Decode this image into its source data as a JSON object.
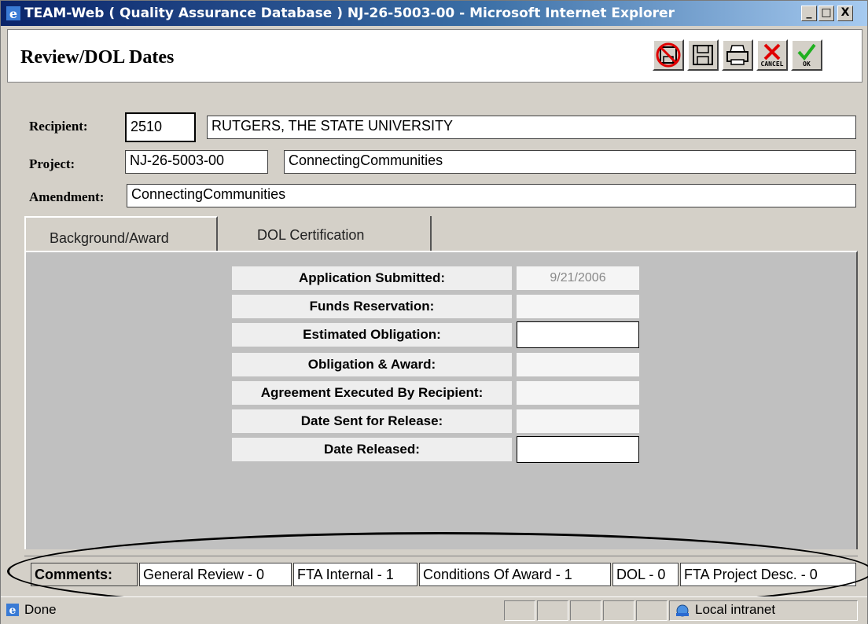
{
  "window": {
    "title": "TEAM-Web ( Quality Assurance Database ) NJ-26-5003-00 - Microsoft Internet Explorer",
    "minimize": "_",
    "maximize": "□",
    "close": "X"
  },
  "header": {
    "title": "Review/DOL Dates",
    "toolbar": {
      "cancel_label": "CANCEL",
      "ok_label": "OK"
    }
  },
  "form": {
    "recipient_label": "Recipient:",
    "recipient_id": "2510",
    "recipient_name": "RUTGERS, THE STATE UNIVERSITY",
    "project_label": "Project:",
    "project_id": "NJ-26-5003-00",
    "project_name": "ConnectingCommunities",
    "amendment_label": "Amendment:",
    "amendment_value": "ConnectingCommunities"
  },
  "tabs": [
    {
      "label": "Background/Award",
      "active": true
    },
    {
      "label": "DOL Certification",
      "active": false
    }
  ],
  "dates": [
    {
      "label": "Application Submitted:",
      "value": "9/21/2006"
    },
    {
      "label": "Funds Reservation:",
      "value": ""
    },
    {
      "label": "Estimated Obligation:",
      "value": ""
    },
    {
      "label": "Obligation & Award:",
      "value": ""
    },
    {
      "label": "Agreement Executed By Recipient:",
      "value": ""
    },
    {
      "label": "Date Sent for Release:",
      "value": ""
    },
    {
      "label": "Date Released:",
      "value": ""
    }
  ],
  "comments": {
    "label": "Comments:",
    "items": [
      "General Review - 0",
      "FTA Internal - 1",
      "Conditions Of Award - 1",
      "DOL - 0",
      "FTA Project Desc. - 0"
    ]
  },
  "statusbar": {
    "status": "Done",
    "zone": "Local intranet"
  },
  "colors": {
    "title_gradient_start": "#0a246a",
    "window_bg": "#d4d0c8",
    "panel_bg": "#c0c0c0"
  }
}
